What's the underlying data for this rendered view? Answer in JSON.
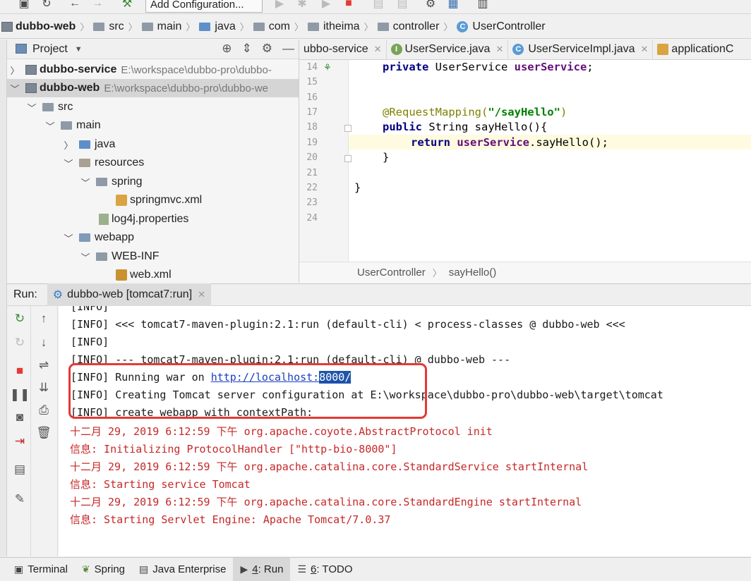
{
  "toolbar": {
    "config_label": "Add Configuration..."
  },
  "breadcrumb": {
    "module": "dubbo-web",
    "items": [
      "src",
      "main",
      "java",
      "com",
      "itheima",
      "controller"
    ],
    "class": "UserController"
  },
  "project": {
    "title": "Project",
    "tree": [
      {
        "label": "dubbo-service",
        "path": "E:\\workspace\\dubbo-pro\\dubbo-"
      },
      {
        "label": "dubbo-web",
        "path": "E:\\workspace\\dubbo-pro\\dubbo-we"
      },
      {
        "label": "src"
      },
      {
        "label": "main"
      },
      {
        "label": "java"
      },
      {
        "label": "resources"
      },
      {
        "label": "spring"
      },
      {
        "label": "springmvc.xml"
      },
      {
        "label": "log4j.properties"
      },
      {
        "label": "webapp"
      },
      {
        "label": "WEB-INF"
      },
      {
        "label": "web.xml"
      }
    ]
  },
  "editor": {
    "tabs": [
      {
        "label": "ubbo-service"
      },
      {
        "label": "UserService.java"
      },
      {
        "label": "UserServiceImpl.java"
      },
      {
        "label": "applicationC"
      }
    ],
    "line_numbers": [
      "14",
      "15",
      "16",
      "17",
      "18",
      "19",
      "20",
      "21",
      "22",
      "23",
      "24"
    ],
    "code": {
      "l14_a": "private ",
      "l14_b": "UserService ",
      "l14_c": "userService",
      "l14_d": ";",
      "l17_a": "@RequestMapping(",
      "l17_b": "\"/sayHello\"",
      "l17_c": ")",
      "l18_a": "public ",
      "l18_b": "String sayHello(){",
      "l19_a": "return ",
      "l19_b": "userService",
      "l19_c": ".sayHello();",
      "l20": "}",
      "l22": "}"
    },
    "breadcrumb": [
      "UserController",
      "sayHello()"
    ]
  },
  "run": {
    "label": "Run:",
    "tab": "dubbo-web [tomcat7:run]",
    "console": {
      "line0": "[INFO]",
      "line1": "[INFO] <<< tomcat7-maven-plugin:2.1:run (default-cli) < process-classes @ dubbo-web <<<",
      "line2": "[INFO]",
      "line3": "[INFO] --- tomcat7-maven-plugin:2.1:run (default-cli) @ dubbo-web ---",
      "line4_a": "[INFO] Running war on ",
      "line4_link_a": "http://localhost:",
      "line4_link_sel": "8000/",
      "line5": "[INFO] Creating Tomcat server configuration at E:\\workspace\\dubbo-pro\\dubbo-web\\target\\tomcat",
      "line6": "[INFO] create webapp with contextPath:",
      "line7": "十二月 29, 2019 6:12:59 下午 org.apache.coyote.AbstractProtocol init",
      "line8": "信息: Initializing ProtocolHandler [\"http-bio-8000\"]",
      "line9": "十二月 29, 2019 6:12:59 下午 org.apache.catalina.core.StandardService startInternal",
      "line10": "信息: Starting service Tomcat",
      "line11": "十二月 29, 2019 6:12:59 下午 org.apache.catalina.core.StandardEngine startInternal",
      "line12": "信息: Starting Servlet Engine: Apache Tomcat/7.0.37"
    }
  },
  "bottom": {
    "terminal": "Terminal",
    "spring": "Spring",
    "java_enterprise": "Java Enterprise",
    "run_num": "4",
    "run_label": ": Run",
    "todo_num": "6",
    "todo_label": ": TODO"
  },
  "colors": {
    "annotation_box": "#e53935",
    "console_error_text": "#c62828",
    "link": "#1a3fbf",
    "selection": "#1e56a8"
  }
}
